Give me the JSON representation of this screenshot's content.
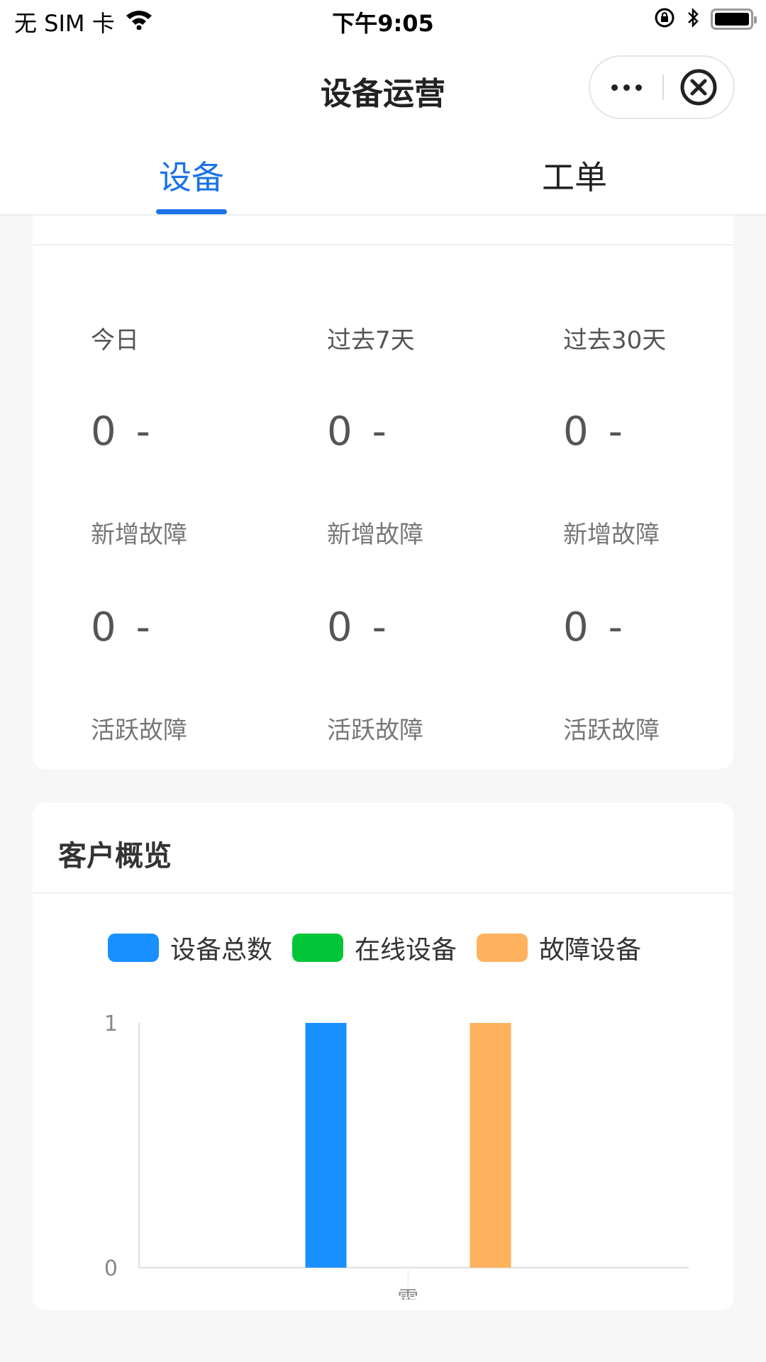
{
  "status_bar": {
    "carrier": "无 SIM 卡",
    "time": "下午9:05",
    "icons": [
      "wifi-icon",
      "rotation-lock-icon",
      "bluetooth-icon",
      "battery-icon"
    ]
  },
  "nav": {
    "title": "设备运营",
    "more_icon": "more-icon",
    "close_icon": "close-circle-icon"
  },
  "tabs": [
    {
      "label": "设备",
      "active": true
    },
    {
      "label": "工单",
      "active": false
    }
  ],
  "stats": {
    "columns": [
      {
        "period": "今日",
        "new_faults": "0",
        "new_faults_trend": "-",
        "new_faults_label": "新增故障",
        "active_faults": "0",
        "active_faults_trend": "-",
        "active_faults_label": "活跃故障"
      },
      {
        "period": "过去7天",
        "new_faults": "0",
        "new_faults_trend": "-",
        "new_faults_label": "新增故障",
        "active_faults": "0",
        "active_faults_trend": "-",
        "active_faults_label": "活跃故障"
      },
      {
        "period": "过去30天",
        "new_faults": "0",
        "new_faults_trend": "-",
        "new_faults_label": "新增故障",
        "active_faults": "0",
        "active_faults_trend": "-",
        "active_faults_label": "活跃故障"
      }
    ]
  },
  "customer_overview": {
    "title": "客户概览"
  },
  "chart_data": {
    "type": "bar",
    "title": "客户概览",
    "xlabel": "",
    "ylabel": "",
    "categories": [
      "霍..."
    ],
    "series": [
      {
        "name": "设备总数",
        "values": [
          1
        ],
        "color": "#1890ff"
      },
      {
        "name": "在线设备",
        "values": [
          0
        ],
        "color": "#00c537"
      },
      {
        "name": "故障设备",
        "values": [
          1
        ],
        "color": "#ffb25e"
      }
    ],
    "ylim": [
      0,
      1
    ],
    "yticks": [
      "0",
      "1"
    ],
    "grid": false,
    "legend_position": "top-center"
  }
}
